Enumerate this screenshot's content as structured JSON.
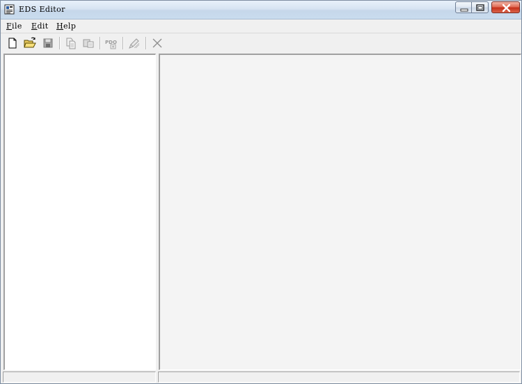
{
  "window": {
    "title": "EDS Editor",
    "buttons": {
      "minimize": "minimize",
      "maximize": "maximize",
      "close": "close"
    }
  },
  "menu": {
    "items": [
      {
        "accel": "F",
        "rest": "ile"
      },
      {
        "accel": "E",
        "rest": "dit"
      },
      {
        "accel": "H",
        "rest": "elp"
      }
    ]
  },
  "toolbar": {
    "icons": [
      "new-file-icon",
      "open-folder-icon",
      "save-icon",
      "copy-icon",
      "paste-icon",
      "pdo-icon",
      "edit-pen-icon",
      "delete-x-icon"
    ],
    "pdo_label": "PDO"
  },
  "status": {
    "left": "",
    "right": ""
  },
  "colors": {
    "title_bar": "#c9dcee",
    "close_button": "#c6321c",
    "chrome": "#f0f0f0",
    "tree_background": "#ffffff",
    "detail_background": "#f4f4f4"
  }
}
